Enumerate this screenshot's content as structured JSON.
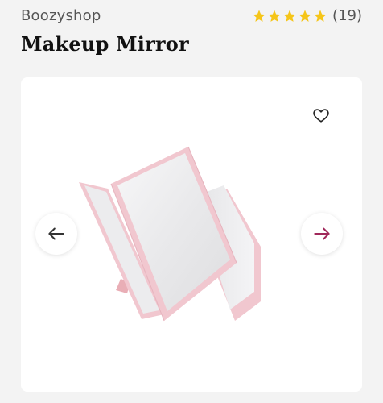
{
  "header": {
    "brand": "Boozyshop",
    "rating": {
      "stars": 5,
      "count_label": "(19)",
      "star_color": "#f5c518"
    },
    "title": "Makeup Mirror"
  },
  "gallery": {
    "favorite_icon": "heart-outline-icon",
    "prev_icon": "arrow-left-icon",
    "next_icon": "arrow-right-icon",
    "prev_color": "#333333",
    "next_color": "#a0285a",
    "image": {
      "subject": "tri-fold-makeup-mirror",
      "frame_color": "#f1c7cf"
    }
  }
}
